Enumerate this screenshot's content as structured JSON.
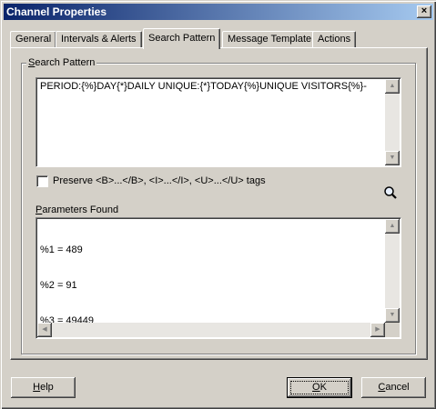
{
  "window": {
    "title": "Channel Properties",
    "close_glyph": "×"
  },
  "tabs": [
    {
      "label": "General",
      "active": false
    },
    {
      "label": "Intervals & Alerts",
      "active": false
    },
    {
      "label": "Search Pattern",
      "active": true
    },
    {
      "label": "Message Template",
      "active": false
    },
    {
      "label": "Actions",
      "active": false
    }
  ],
  "search_pattern": {
    "group_label_mnemonic": "S",
    "group_label_rest": "earch Pattern",
    "value": "PERIOD:{%}DAY{*}DAILY UNIQUE:{*}TODAY{%}UNIQUE VISITORS{%}-"
  },
  "preserve_tags": {
    "label": "Preserve <B>...</B>, <I>...</I>, <U>...</U> tags",
    "checked": false
  },
  "parameters": {
    "label_mnemonic": "P",
    "label_rest": "arameters Found",
    "lines": [
      "%1 = 489",
      "%2 = 91",
      "%3 = 49449"
    ]
  },
  "buttons": {
    "help_mnemonic": "H",
    "help_rest": "elp",
    "ok_mnemonic": "O",
    "ok_rest": "K",
    "cancel_mnemonic": "C",
    "cancel_rest": "ancel"
  },
  "icons": {
    "magnifier": "search-icon",
    "scroll_up": "▲",
    "scroll_down": "▼",
    "scroll_left": "◀",
    "scroll_right": "▶"
  },
  "colors": {
    "dialog_bg": "#d4d0c8",
    "titlebar_start": "#0a246a",
    "titlebar_end": "#a6caf0"
  }
}
